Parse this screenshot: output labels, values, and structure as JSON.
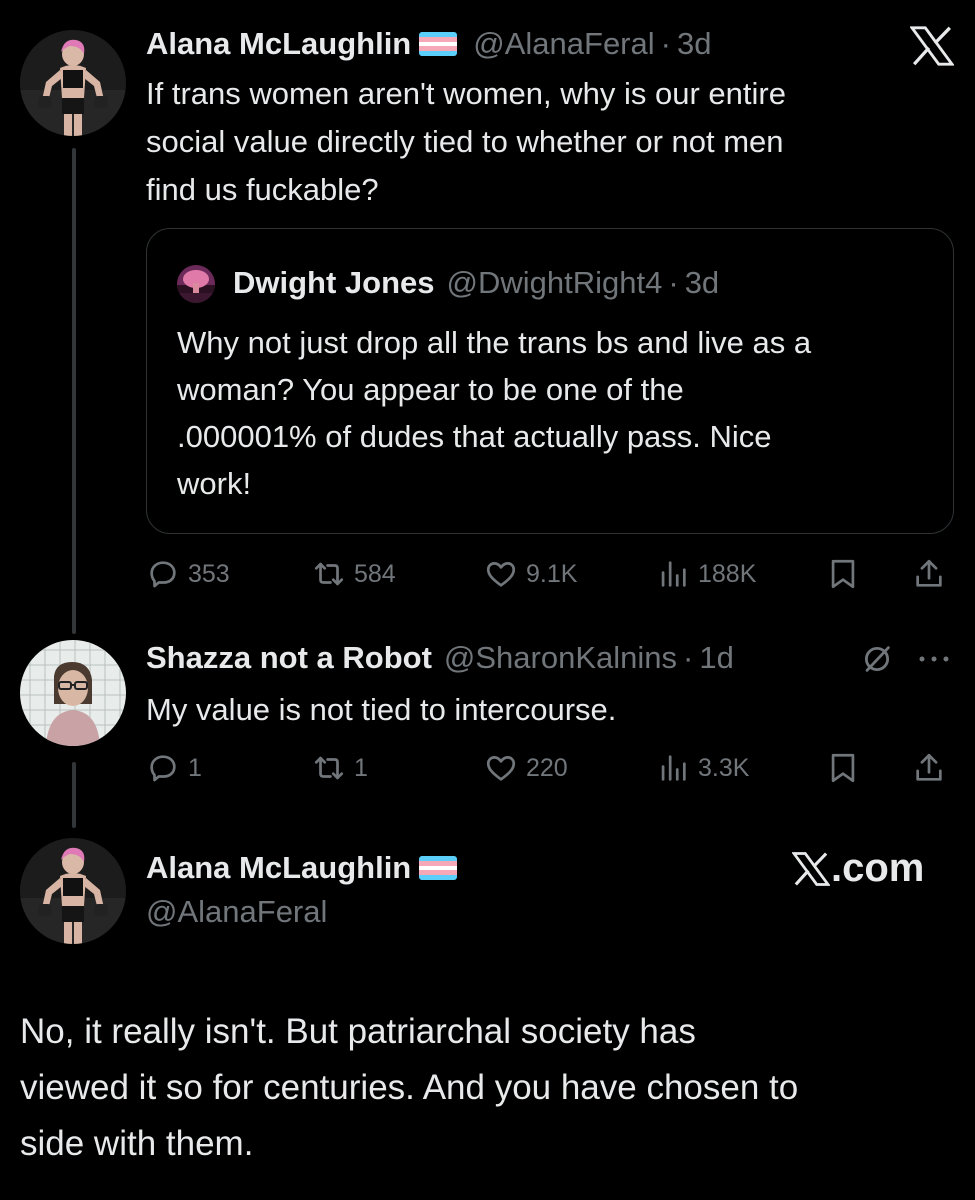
{
  "colors": {
    "background": "#000000",
    "text": "#e7e9ea",
    "muted": "#71767b",
    "border": "#2f3336",
    "flag_blue": "#5bcefa",
    "flag_pink": "#f5a9b8",
    "flag_white": "#ffffff"
  },
  "tweet1": {
    "author_name": "Alana McLaughlin",
    "handle": "@AlanaFeral",
    "separator": "·",
    "time": "3d",
    "body": [
      "If trans women aren't women, why is our entire",
      "social value directly tied to whether or not men",
      "find us fuckable?"
    ],
    "quote": {
      "author_name": "Dwight Jones",
      "handle": "@DwightRight4",
      "separator": "·",
      "time": "3d",
      "body": [
        "Why not just drop all the trans bs and live as a",
        "woman? You appear to be one of the",
        ".000001% of dudes that actually pass. Nice",
        "work!"
      ]
    },
    "stats": {
      "replies": "353",
      "reposts": "584",
      "likes": "9.1K",
      "views": "188K"
    }
  },
  "tweet2": {
    "author_name": "Shazza not a Robot",
    "handle": "@SharonKalnins",
    "separator": "·",
    "time": "1d",
    "body": "My value is not tied to intercourse.",
    "stats": {
      "replies": "1",
      "reposts": "1",
      "likes": "220",
      "views": "3.3K"
    }
  },
  "tweet3": {
    "author_name": "Alana McLaughlin",
    "handle": "@AlanaFeral",
    "brand": ".com",
    "body": [
      "No, it really isn't. But patriarchal society has",
      "viewed it so for centuries. And you have chosen to",
      "side with them."
    ]
  },
  "icons": [
    "x-logo-icon",
    "reply-icon",
    "repost-icon",
    "like-icon",
    "views-icon",
    "bookmark-icon",
    "share-icon",
    "blocked-icon",
    "more-icon",
    "trans-flag-icon"
  ]
}
